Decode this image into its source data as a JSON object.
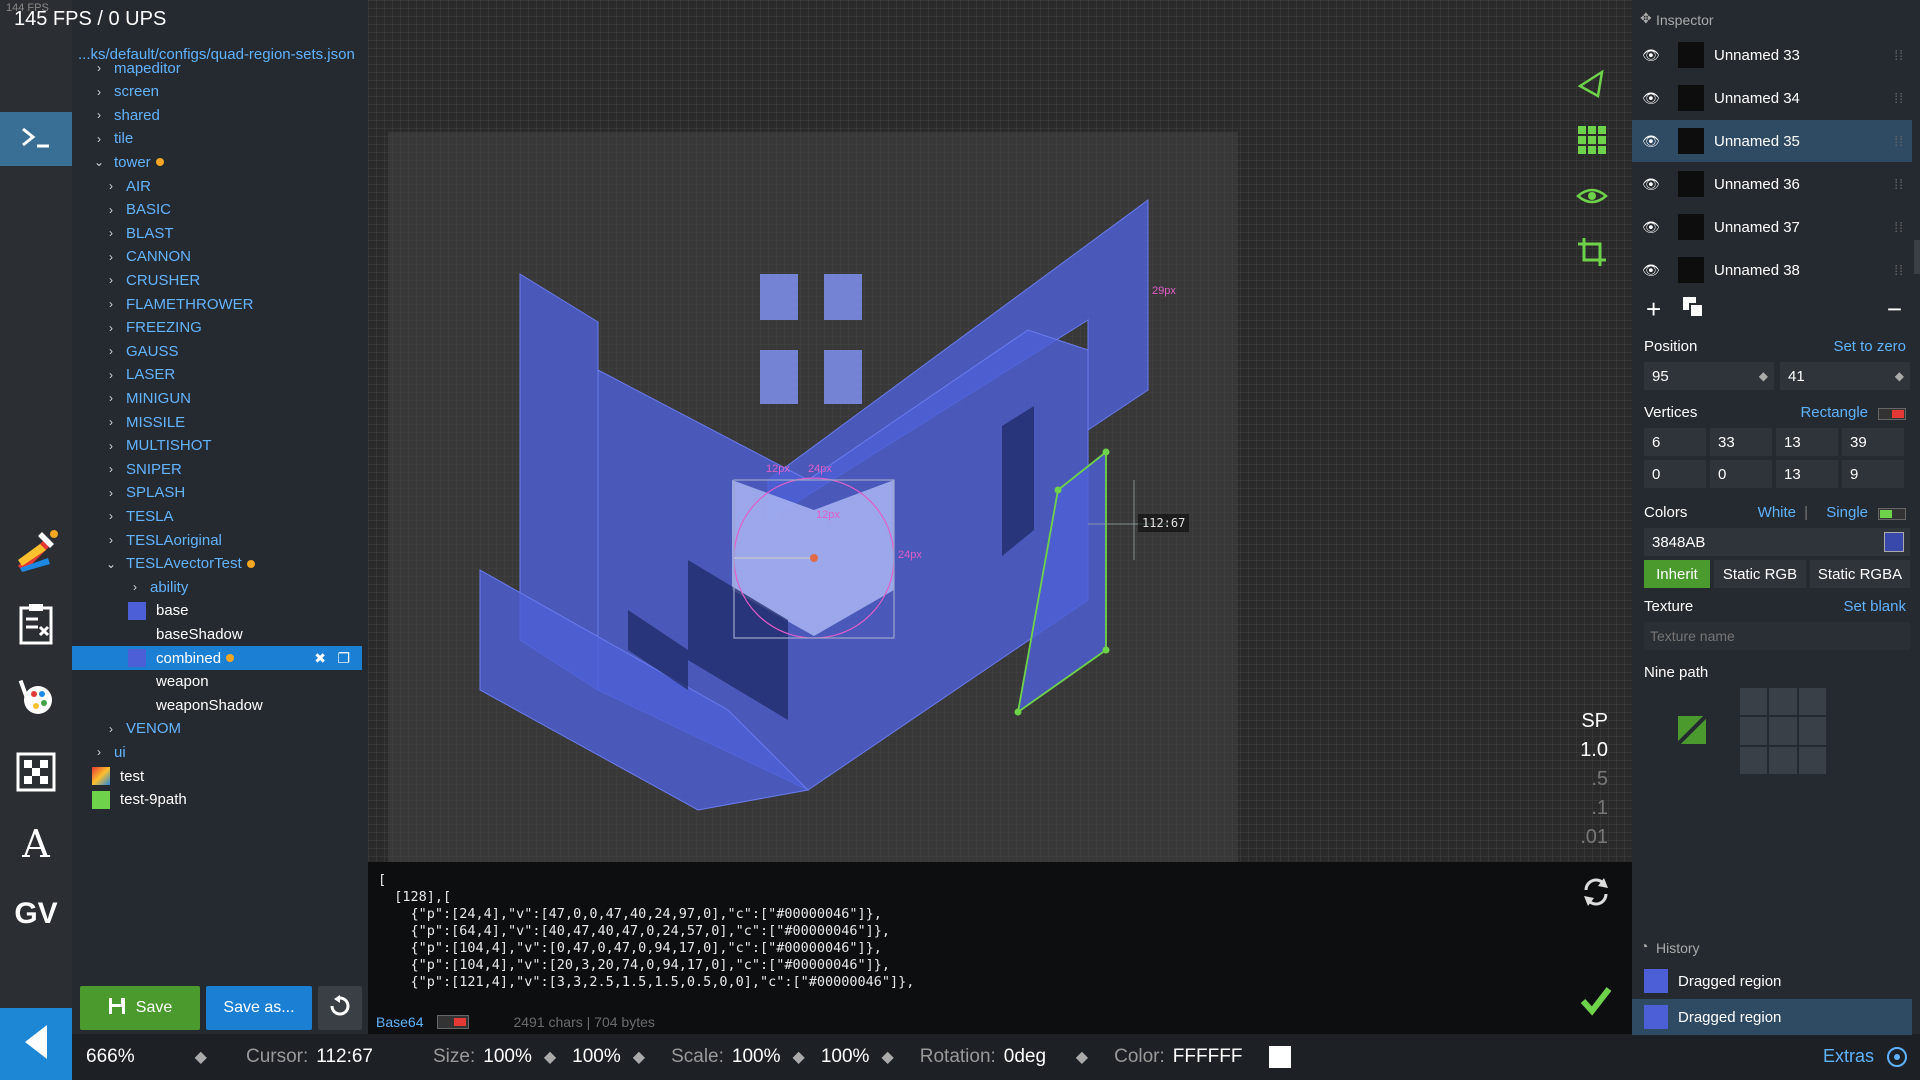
{
  "fps": {
    "main": "145 FPS / 0 UPS",
    "small": "144 FPS"
  },
  "filetree": {
    "path": "...ks/default/configs/quad-region-sets.json",
    "items": [
      {
        "label": "mapeditor",
        "kind": "folder"
      },
      {
        "label": "screen",
        "kind": "folder"
      },
      {
        "label": "shared",
        "kind": "folder"
      },
      {
        "label": "tile",
        "kind": "folder"
      },
      {
        "label": "tower",
        "kind": "folder-open",
        "modified": true
      },
      {
        "label": "AIR",
        "kind": "folder"
      },
      {
        "label": "BASIC",
        "kind": "folder"
      },
      {
        "label": "BLAST",
        "kind": "folder"
      },
      {
        "label": "CANNON",
        "kind": "folder"
      },
      {
        "label": "CRUSHER",
        "kind": "folder"
      },
      {
        "label": "FLAMETHROWER",
        "kind": "folder"
      },
      {
        "label": "FREEZING",
        "kind": "folder"
      },
      {
        "label": "GAUSS",
        "kind": "folder"
      },
      {
        "label": "LASER",
        "kind": "folder"
      },
      {
        "label": "MINIGUN",
        "kind": "folder"
      },
      {
        "label": "MISSILE",
        "kind": "folder"
      },
      {
        "label": "MULTISHOT",
        "kind": "folder"
      },
      {
        "label": "SNIPER",
        "kind": "folder"
      },
      {
        "label": "SPLASH",
        "kind": "folder"
      },
      {
        "label": "TESLA",
        "kind": "folder"
      },
      {
        "label": "TESLAoriginal",
        "kind": "folder"
      },
      {
        "label": "TESLAvectorTest",
        "kind": "folder-open",
        "modified": true
      },
      {
        "label": "ability",
        "kind": "folder"
      },
      {
        "label": "base",
        "kind": "file"
      },
      {
        "label": "baseShadow",
        "kind": "file"
      },
      {
        "label": "combined",
        "kind": "file",
        "modified": true,
        "selected": true
      },
      {
        "label": "weapon",
        "kind": "file"
      },
      {
        "label": "weaponShadow",
        "kind": "file"
      },
      {
        "label": "VENOM",
        "kind": "folder"
      },
      {
        "label": "ui",
        "kind": "folder"
      },
      {
        "label": "test",
        "kind": "file"
      },
      {
        "label": "test-9path",
        "kind": "file"
      }
    ],
    "save_label": "Save",
    "save_as_label": "Save as..."
  },
  "canvas": {
    "coord_tag": "112:67",
    "dimension_labels": [
      "29px",
      "12px",
      "24px",
      "12px",
      "24px"
    ],
    "speed": {
      "label": "SP",
      "options": [
        "1.0",
        ".5",
        ".1",
        ".01"
      ]
    },
    "fill_color": "#3848AB"
  },
  "code": {
    "lines": [
      "[",
      "  [128],[",
      "    {\"p\":[24,4],\"v\":[47,0,0,47,40,24,97,0],\"c\":[\"#00000046\"]},",
      "    {\"p\":[64,4],\"v\":[40,47,40,47,0,24,57,0],\"c\":[\"#00000046\"]},",
      "    {\"p\":[104,4],\"v\":[0,47,0,47,0,94,17,0],\"c\":[\"#00000046\"]},",
      "    {\"p\":[104,4],\"v\":[20,3,20,74,0,94,17,0],\"c\":[\"#00000046\"]},",
      "    {\"p\":[121,4],\"v\":[3,3,2.5,1.5,1.5,0.5,0,0],\"c\":[\"#00000046\"]},"
    ],
    "format_label": "Base64",
    "stats": "2491 chars | 704 bytes"
  },
  "statusbar": {
    "zoom": "666%",
    "cursor_label": "Cursor:",
    "cursor_value": "112:67",
    "size_label": "Size:",
    "size_x": "100%",
    "size_y": "100%",
    "scale_label": "Scale:",
    "scale_x": "100%",
    "scale_y": "100%",
    "rotation_label": "Rotation:",
    "rotation_value": "0deg",
    "color_label": "Color:",
    "color_value": "FFFFFF",
    "extras_label": "Extras"
  },
  "inspector": {
    "title": "Inspector",
    "layers": [
      {
        "label": "Unnamed 33"
      },
      {
        "label": "Unnamed 34"
      },
      {
        "label": "Unnamed 35",
        "active": true
      },
      {
        "label": "Unnamed 36"
      },
      {
        "label": "Unnamed 37"
      },
      {
        "label": "Unnamed 38"
      }
    ],
    "position": {
      "label": "Position",
      "action": "Set to zero",
      "x": "95",
      "y": "41"
    },
    "vertices": {
      "label": "Vertices",
      "action": "Rectangle",
      "values": [
        "6",
        "33",
        "13",
        "39",
        "0",
        "0",
        "13",
        "9"
      ]
    },
    "colors": {
      "label": "Colors",
      "white": "White",
      "separator": "|",
      "single": "Single",
      "hex": "3848AB",
      "swatch": "#3848AB",
      "modes": [
        "Inherit",
        "Static RGB",
        "Static RGBA"
      ]
    },
    "texture": {
      "label": "Texture",
      "action": "Set blank",
      "placeholder": "Texture name"
    },
    "nine_path": {
      "label": "Nine path"
    },
    "history": {
      "title": "History",
      "items": [
        "Dragged region",
        "Dragged region"
      ]
    }
  }
}
